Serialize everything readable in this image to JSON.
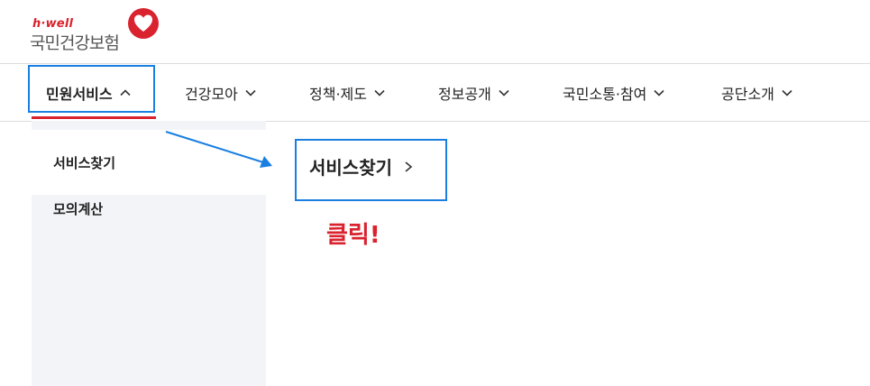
{
  "logo": {
    "sub_text": "h·well",
    "main_text": "국민건강보험",
    "brand_color": "#d9232e"
  },
  "gnb": {
    "items": [
      {
        "label": "민원서비스",
        "icon": "chevron-up-icon",
        "active": true
      },
      {
        "label": "건강모아",
        "icon": "chevron-down-icon"
      },
      {
        "label": "정책·제도",
        "icon": "chevron-down-icon"
      },
      {
        "label": "정보공개",
        "icon": "chevron-down-icon"
      },
      {
        "label": "국민소통·참여",
        "icon": "chevron-down-icon"
      },
      {
        "label": "공단소개",
        "icon": "chevron-down-icon"
      }
    ]
  },
  "submenu": {
    "items": [
      {
        "label": "서비스찾기",
        "active": true
      },
      {
        "label": "모의계산"
      }
    ]
  },
  "service_link": {
    "label": "서비스찾기",
    "icon": "chevron-right-icon"
  },
  "annotation": {
    "text": "클릭!",
    "highlight_color": "#1a7fe0",
    "text_color": "#d9232e"
  }
}
